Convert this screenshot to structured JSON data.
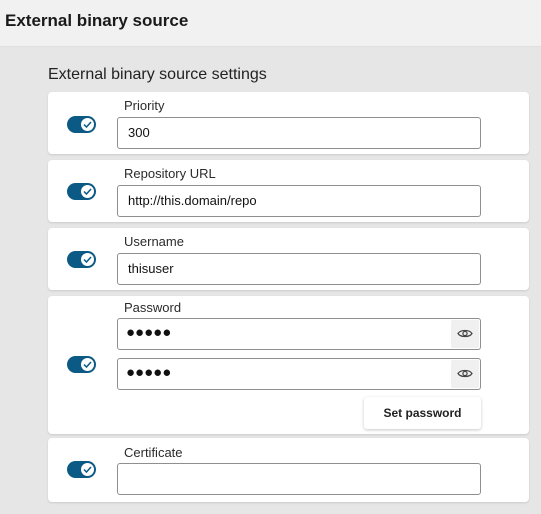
{
  "header": {
    "title": "External binary source"
  },
  "section": {
    "title": "External binary source settings"
  },
  "fields": {
    "priority": {
      "label": "Priority",
      "value": "300",
      "enabled": true
    },
    "repository_url": {
      "label": "Repository URL",
      "value": "http://this.domain/repo",
      "enabled": true
    },
    "username": {
      "label": "Username",
      "value": "thisuser",
      "enabled": true
    },
    "password": {
      "label": "Password",
      "masked_value": "●●●●●",
      "confirm_masked_value": "●●●●●",
      "show_icon": "eye-icon",
      "set_button_label": "Set password",
      "enabled": true
    },
    "certificate": {
      "label": "Certificate",
      "value": "",
      "enabled": true
    }
  },
  "colors": {
    "toggle_on": "#0b5a86",
    "page_bg": "#e6e6e6",
    "header_bg": "#f1f1f1"
  }
}
